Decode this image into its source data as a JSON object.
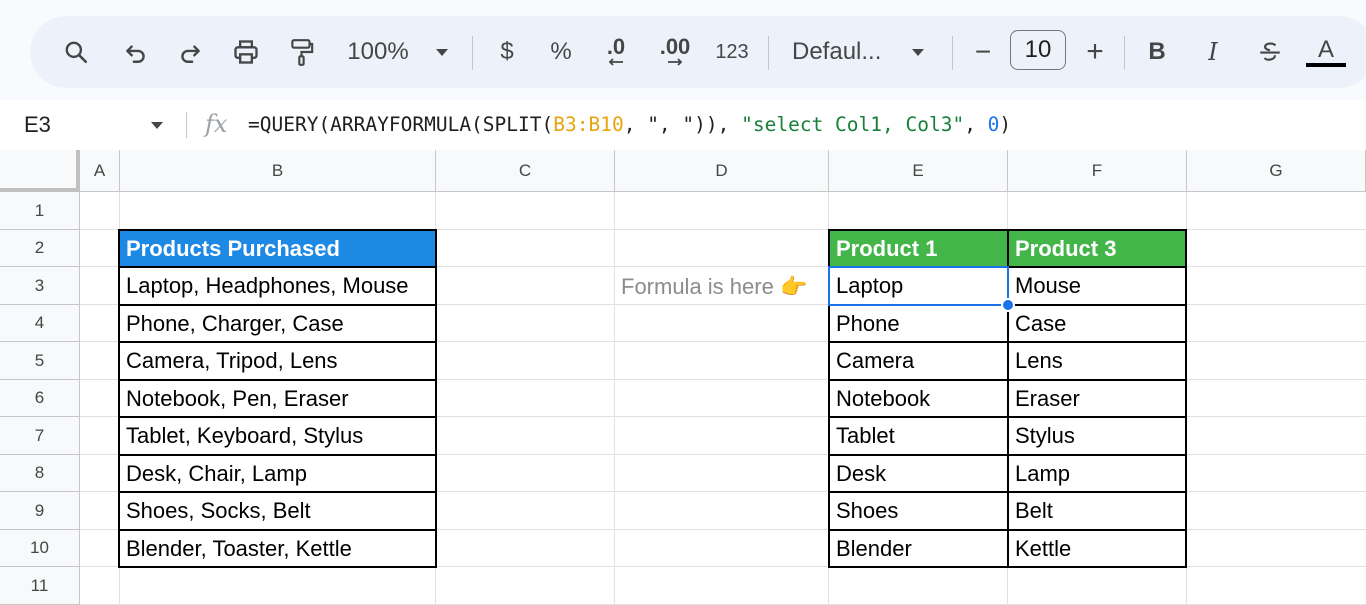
{
  "toolbar": {
    "zoom": "100%",
    "currency": "$",
    "percent": "%",
    "decrease_decimal": ".0",
    "increase_decimal": ".00",
    "number_format": "123",
    "font_family": "Defaul...",
    "font_size": "10",
    "minus": "−",
    "plus": "+",
    "bold": "B",
    "italic": "I",
    "text_color": "A"
  },
  "formula_bar": {
    "name_box": "E3",
    "fx": "fx",
    "formula_parts": {
      "p1": "=QUERY(ARRAYFORMULA(SPLIT(",
      "p2": "B3:B10",
      "p3": ", ",
      "p4": "\", \"",
      "p5": ")), ",
      "p6": "\"select Col1, Col3\"",
      "p7": ", ",
      "p8": "0",
      "p9": ")"
    }
  },
  "columns": [
    "A",
    "B",
    "C",
    "D",
    "E",
    "F",
    "G"
  ],
  "rows": [
    "1",
    "2",
    "3",
    "4",
    "5",
    "6",
    "7",
    "8",
    "9",
    "10",
    "11"
  ],
  "cells": {
    "b_header": "Products Purchased",
    "b_values": [
      "Laptop, Headphones, Mouse",
      "Phone, Charger, Case",
      "Camera, Tripod, Lens",
      "Notebook, Pen, Eraser",
      "Tablet, Keyboard, Stylus",
      "Desk, Chair, Lamp",
      "Shoes, Socks, Belt",
      "Blender, Toaster, Kettle"
    ],
    "d3_note": "Formula is here 👉",
    "e_header": "Product 1",
    "f_header": "Product 3",
    "e_values": [
      "Laptop",
      "Phone",
      "Camera",
      "Notebook",
      "Tablet",
      "Desk",
      "Shoes",
      "Blender"
    ],
    "f_values": [
      "Mouse",
      "Case",
      "Lens",
      "Eraser",
      "Stylus",
      "Lamp",
      "Belt",
      "Kettle"
    ]
  },
  "colors": {
    "header_blue": "#1e88e5",
    "header_green": "#43b549",
    "selection": "#1a73e8"
  }
}
